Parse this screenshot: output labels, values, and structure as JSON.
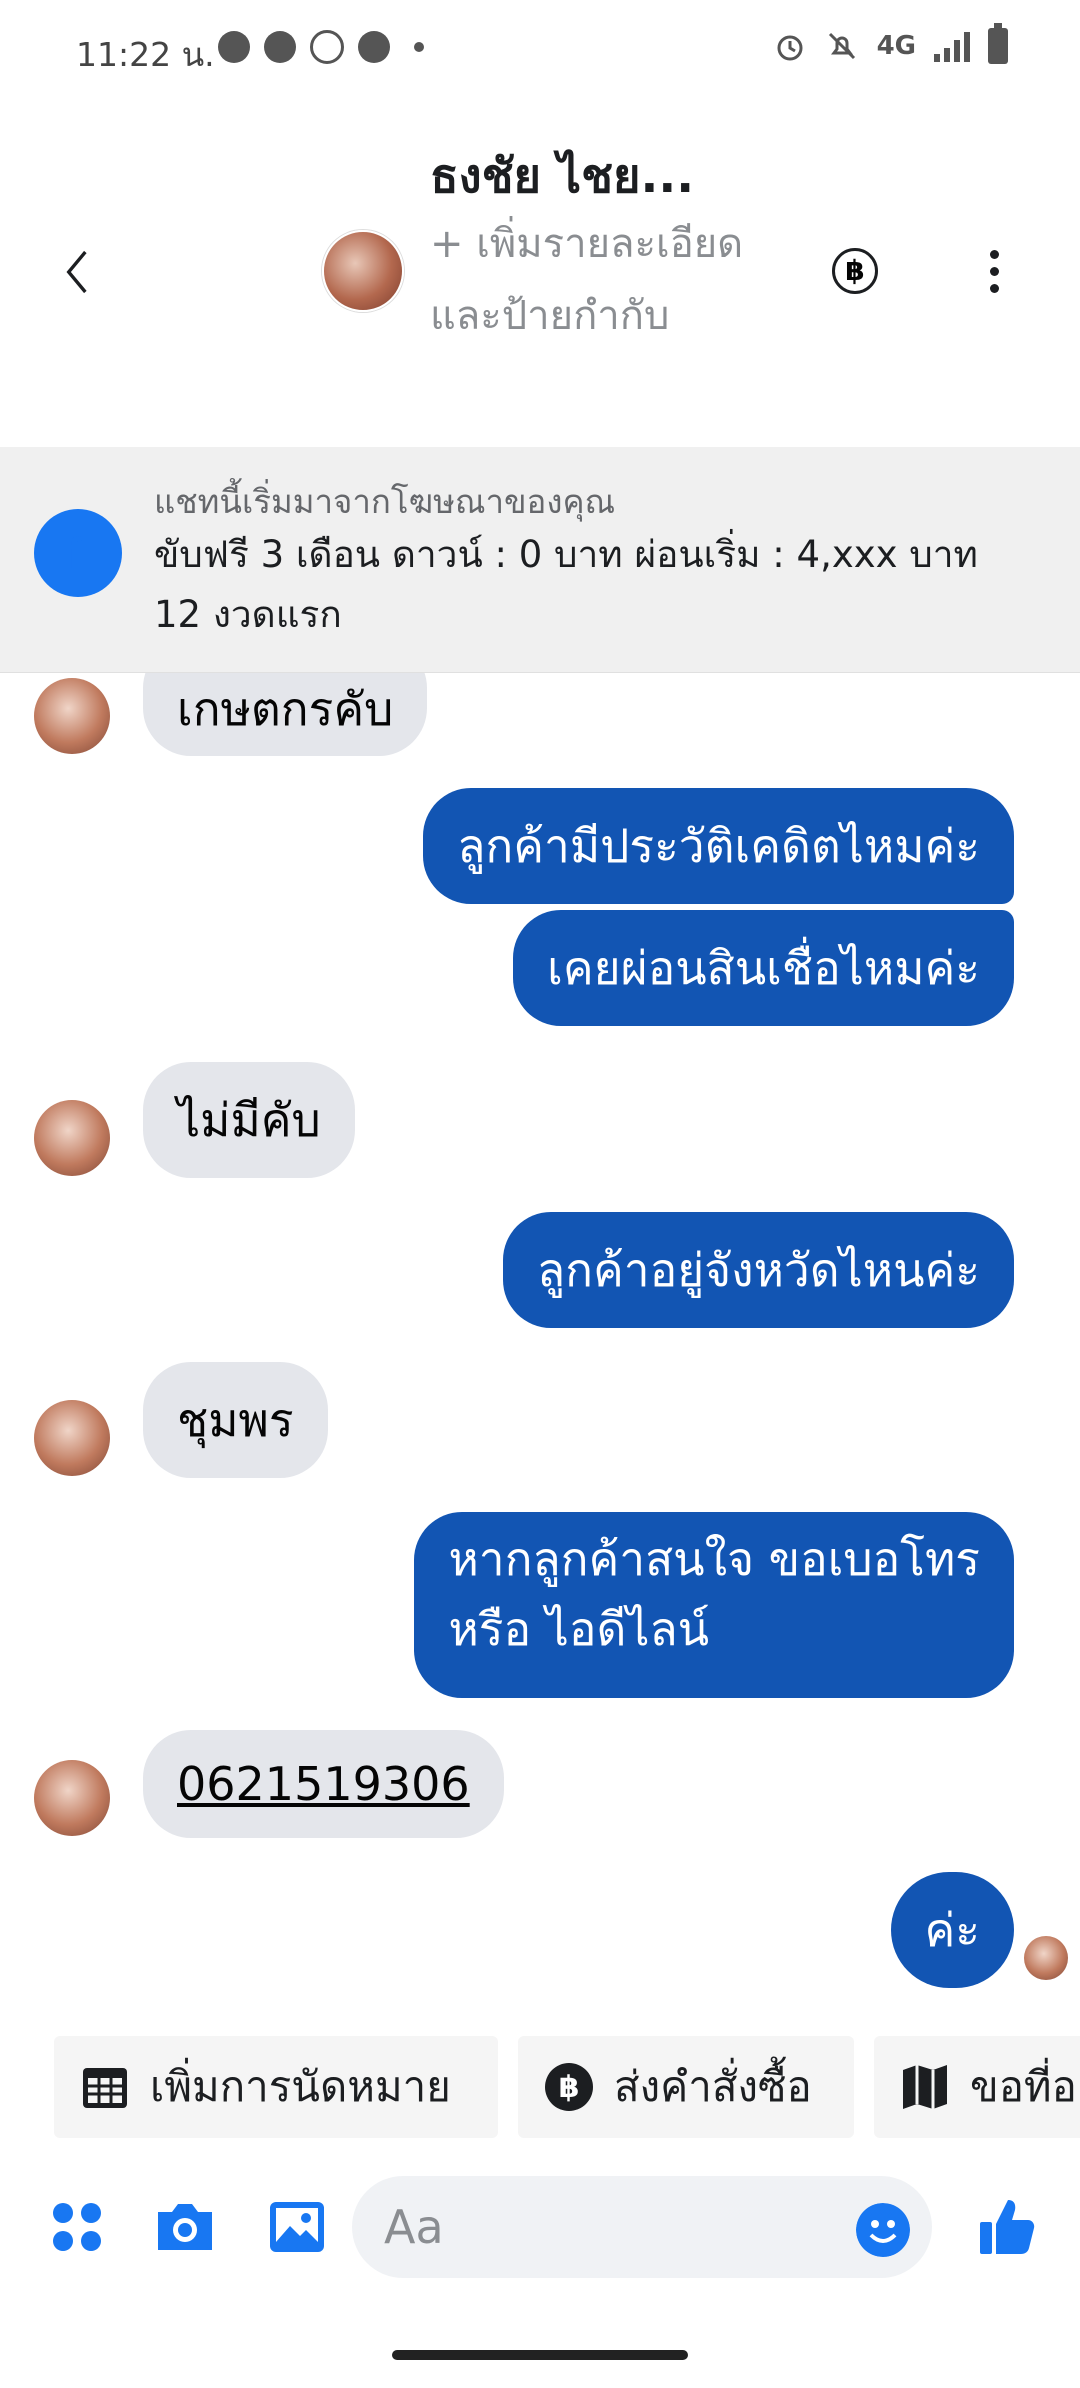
{
  "status_bar": {
    "time": "11:22 น.",
    "network": "4G"
  },
  "header": {
    "contact_name": "ธงชัย ไชย...",
    "subtitle": "+ เพิ่มรายละเอียดและป้ายกำกับ",
    "payment_symbol": "฿"
  },
  "ad_banner": {
    "caption": "แชทนี้เริ่มมาจากโฆษณาของคุณ",
    "text": "ขับฟรี 3 เดือน ดาวน์ : 0 บาท ผ่อนเริ่ม : 4,xxx บาท 12 งวดแรก"
  },
  "messages": [
    {
      "side": "in",
      "text": "เกษตกรคับ"
    },
    {
      "side": "out",
      "text": "ลูกค้ามีประวัติเคดิตไหมค่ะ"
    },
    {
      "side": "out",
      "text": "เคยผ่อนสินเชื่อไหมค่ะ"
    },
    {
      "side": "in",
      "text": "ไม่มีคับ"
    },
    {
      "side": "out",
      "text": "ลูกค้าอยู่จังหวัดไหนค่ะ"
    },
    {
      "side": "in",
      "text": "ชุมพร"
    },
    {
      "side": "out",
      "line1": "หากลูกค้าสนใจ ขอเบอโทร",
      "line2": "หรือ ไอดีไลน์"
    },
    {
      "side": "in",
      "text": "0621519306"
    },
    {
      "side": "out",
      "text": "ค่ะ"
    }
  ],
  "quick_actions": [
    {
      "label": "เพิ่มการนัดหมาย",
      "icon": "calendar-icon"
    },
    {
      "label": "ส่งคำสั่งซื้อ",
      "icon": "baht-icon"
    },
    {
      "label": "ขอที่อ",
      "icon": "map-icon"
    }
  ],
  "composer": {
    "placeholder": "Aa"
  },
  "colors": {
    "accent": "#1877f2",
    "outgoing_bubble": "#1255b3",
    "incoming_bubble": "#e4e6eb"
  }
}
